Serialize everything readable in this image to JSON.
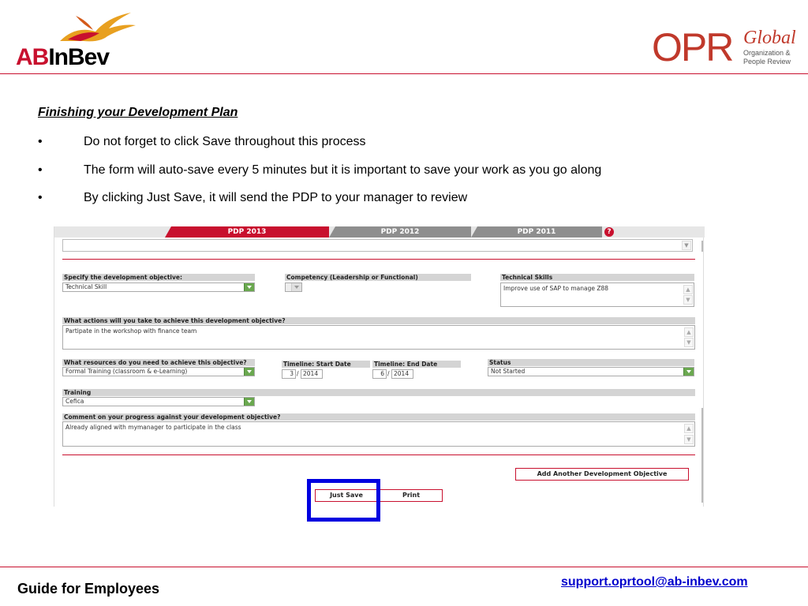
{
  "header": {
    "left_logo_text_ab": "AB",
    "left_logo_text_inbev": "InBev",
    "right_logo_main": "OPR",
    "right_logo_global": "Global",
    "right_logo_sub1": "Organization &",
    "right_logo_sub2": "People Review",
    "accent_color": "#c8102e"
  },
  "content": {
    "title": "Finishing your Development Plan",
    "bullets": [
      "Do not forget to click Save throughout this process",
      "The form will auto-save every 5 minutes but it is important to save your work as you go along",
      "By clicking Just Save, it will send the PDP to your manager to review"
    ],
    "bullet_symbol": "•"
  },
  "form": {
    "tabs": [
      "PDP 2013",
      "PDP 2012",
      "PDP 2011"
    ],
    "help_icon": "?",
    "fields": {
      "dev_objective_label": "Specify the development objective:",
      "dev_objective_value": "Technical Skill",
      "competency_label": "Competency (Leadership or Functional)",
      "competency_value": "",
      "tech_skills_label": "Technical Skills",
      "tech_skills_value": "Improve use of SAP to manage Z88",
      "actions_label": "What actions will you take to achieve this development objective?",
      "actions_value": "Partipate in the workshop with finance team",
      "resources_label": "What resources do you need to achieve this objective?",
      "resources_value": "Formal Training (classroom & e-Learning)",
      "start_date_label": "Timeline: Start Date",
      "start_month": "3",
      "start_year": "2014",
      "end_date_label": "Timeline: End Date",
      "end_month": "6",
      "end_year": "2014",
      "date_separator": "/",
      "status_label": "Status",
      "status_value": "Not Started",
      "training_label": "Training",
      "training_value": "Cefica",
      "comment_label": "Comment on your progress against your development objective?",
      "comment_value": "Already aligned with mymanager to participate in the class"
    },
    "buttons": {
      "add_objective": "Add Another Development Objective",
      "just_save": "Just Save",
      "print": "Print"
    },
    "highlight_color": "#0000e0"
  },
  "footer": {
    "left_text": "Guide for Employees",
    "email": "support.oprtool@ab-inbev.com"
  }
}
